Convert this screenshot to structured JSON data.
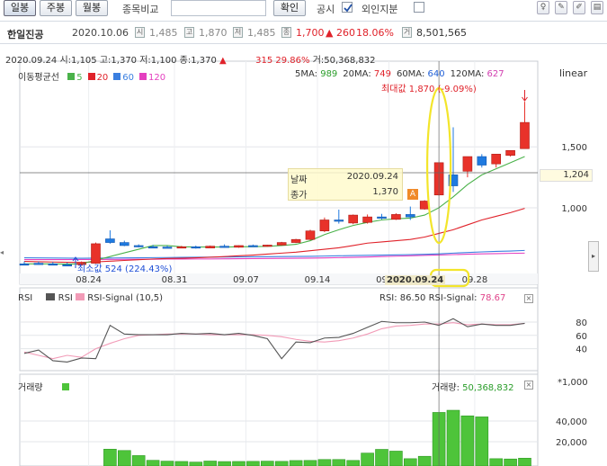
{
  "toolbar": {
    "daily": "일봉",
    "weekly": "주봉",
    "monthly": "월봉",
    "compare_label": "종목비교",
    "confirm": "확인",
    "disclosure": "공시",
    "foreign": "외인지분"
  },
  "quote": {
    "name": "한일진공",
    "date": "2020.10.06",
    "open_icon": "시",
    "open": "1,485",
    "high_icon": "고",
    "high": "1,870",
    "low_icon": "저",
    "low": "1,485",
    "close_icon": "종",
    "close": "1,700",
    "change": "▲ 260",
    "pct": "18.06%",
    "vol_icon": "거",
    "volume": "8,501,565"
  },
  "info": {
    "date": "2020.09.24",
    "open": "시:1,105",
    "high": "고:1,370",
    "low": "저:1,100",
    "close": "종:1,370",
    "arrow": "▲",
    "change": "315",
    "pct": "29.86%",
    "volume": "거:50,368,832"
  },
  "ma_legend": {
    "title": "이동평균선",
    "items": [
      {
        "label": "5",
        "color": "#4ab24a"
      },
      {
        "label": "20",
        "color": "#e0222a"
      },
      {
        "label": "60",
        "color": "#3a7fe0"
      },
      {
        "label": "120",
        "color": "#e43fbf"
      }
    ],
    "values": [
      {
        "label": "5MA:",
        "value": "989",
        "color": "#2a9d2a"
      },
      {
        "label": "20MA:",
        "value": "749",
        "color": "#e0222a"
      },
      {
        "label": "60MA:",
        "value": "640",
        "color": "#1f5fd6"
      },
      {
        "label": "120MA:",
        "value": "627",
        "color": "#d23fb0"
      }
    ],
    "scale": "linear"
  },
  "annotations": {
    "max": "최대값 1,870 (-9.09%)",
    "min": "최소값 524 (224.43%)",
    "tooltip_date_label": "날짜",
    "tooltip_date": "2020.09.24",
    "tooltip_close_label": "종가",
    "tooltip_close": "1,370",
    "crosshair_price": "1,204",
    "crosshair_date": "2020.09.24",
    "marker": "A"
  },
  "rsi": {
    "title": "RSI",
    "legend1": "RSI",
    "legend2": "RSI-Signal (10,5)",
    "readout": "RSI: 86.50",
    "readout_signal": "RSI-Signal:",
    "signal_value": "78.67"
  },
  "volume": {
    "title": "거래량",
    "readout": "거래량:",
    "value": "50,368,832",
    "unit": "*1,000"
  },
  "chart_data": {
    "type": "candlestick",
    "x_ticks": [
      "08.24",
      "08.31",
      "09.07",
      "09.14",
      "09.21",
      "09.28"
    ],
    "price_ticks": [
      1000,
      1500
    ],
    "candles": [
      {
        "o": 540,
        "h": 560,
        "c": 540,
        "l": 528,
        "up": false
      },
      {
        "o": 545,
        "h": 560,
        "c": 540,
        "l": 532,
        "up": false
      },
      {
        "o": 540,
        "h": 555,
        "c": 535,
        "l": 528,
        "up": false
      },
      {
        "o": 533,
        "h": 550,
        "c": 528,
        "l": 524,
        "up": false
      },
      {
        "o": 535,
        "h": 560,
        "c": 545,
        "l": 524,
        "up": true
      },
      {
        "o": 545,
        "h": 715,
        "c": 705,
        "l": 540,
        "up": true
      },
      {
        "o": 745,
        "h": 815,
        "c": 715,
        "l": 705,
        "up": false
      },
      {
        "o": 715,
        "h": 730,
        "c": 690,
        "l": 685,
        "up": false
      },
      {
        "o": 690,
        "h": 700,
        "c": 680,
        "l": 675,
        "up": false
      },
      {
        "o": 680,
        "h": 695,
        "c": 678,
        "l": 670,
        "up": false
      },
      {
        "o": 678,
        "h": 690,
        "c": 672,
        "l": 668,
        "up": false
      },
      {
        "o": 672,
        "h": 688,
        "c": 680,
        "l": 668,
        "up": true
      },
      {
        "o": 680,
        "h": 690,
        "c": 670,
        "l": 665,
        "up": false
      },
      {
        "o": 670,
        "h": 690,
        "c": 685,
        "l": 668,
        "up": true
      },
      {
        "o": 685,
        "h": 700,
        "c": 676,
        "l": 672,
        "up": false
      },
      {
        "o": 676,
        "h": 692,
        "c": 690,
        "l": 672,
        "up": true
      },
      {
        "o": 690,
        "h": 698,
        "c": 683,
        "l": 680,
        "up": false
      },
      {
        "o": 683,
        "h": 697,
        "c": 694,
        "l": 680,
        "up": true
      },
      {
        "o": 694,
        "h": 720,
        "c": 715,
        "l": 690,
        "up": true
      },
      {
        "o": 715,
        "h": 745,
        "c": 740,
        "l": 710,
        "up": true
      },
      {
        "o": 740,
        "h": 820,
        "c": 810,
        "l": 735,
        "up": true
      },
      {
        "o": 810,
        "h": 920,
        "c": 900,
        "l": 800,
        "up": true
      },
      {
        "o": 900,
        "h": 985,
        "c": 895,
        "l": 870,
        "up": false
      },
      {
        "o": 875,
        "h": 945,
        "c": 940,
        "l": 865,
        "up": true
      },
      {
        "o": 880,
        "h": 945,
        "c": 925,
        "l": 870,
        "up": true
      },
      {
        "o": 925,
        "h": 950,
        "c": 918,
        "l": 905,
        "up": false
      },
      {
        "o": 905,
        "h": 955,
        "c": 945,
        "l": 900,
        "up": true
      },
      {
        "o": 945,
        "h": 1010,
        "c": 925,
        "l": 900,
        "up": false
      },
      {
        "o": 990,
        "h": 1062,
        "c": 1055,
        "l": 985,
        "up": true
      },
      {
        "o": 1105,
        "h": 1370,
        "c": 1370,
        "l": 1100,
        "up": true
      },
      {
        "o": 1270,
        "h": 1660,
        "c": 1180,
        "l": 1130,
        "up": false
      },
      {
        "o": 1300,
        "h": 1420,
        "c": 1420,
        "l": 1250,
        "up": true
      },
      {
        "o": 1420,
        "h": 1440,
        "c": 1350,
        "l": 1330,
        "up": false
      },
      {
        "o": 1360,
        "h": 1440,
        "c": 1440,
        "l": 1330,
        "up": true
      },
      {
        "o": 1430,
        "h": 1470,
        "c": 1470,
        "l": 1420,
        "up": true
      },
      {
        "o": 1485,
        "h": 1870,
        "c": 1700,
        "l": 1485,
        "up": true
      }
    ],
    "ma5": [
      540,
      540,
      540,
      538,
      540,
      570,
      600,
      630,
      660,
      690,
      690,
      680,
      678,
      678,
      678,
      680,
      681,
      684,
      690,
      700,
      730,
      780,
      820,
      855,
      880,
      900,
      910,
      915,
      940,
      1000,
      1090,
      1190,
      1270,
      1320,
      1370,
      1420
    ],
    "ma20": [
      560,
      557,
      555,
      553,
      552,
      556,
      562,
      568,
      574,
      580,
      584,
      586,
      590,
      594,
      600,
      606,
      612,
      620,
      628,
      636,
      648,
      660,
      672,
      690,
      710,
      720,
      730,
      740,
      760,
      790,
      820,
      860,
      900,
      930,
      960,
      995
    ],
    "ma60": [
      590,
      589,
      588,
      587,
      586,
      587,
      588,
      589,
      590,
      591,
      592,
      593,
      594,
      595,
      596,
      597,
      598,
      599,
      600,
      601,
      602,
      604,
      606,
      608,
      610,
      612,
      614,
      616,
      618,
      622,
      628,
      633,
      638,
      642,
      645,
      650
    ],
    "ma120": [
      575,
      575,
      575,
      575,
      576,
      576,
      577,
      577,
      578,
      578,
      579,
      579,
      580,
      580,
      581,
      582,
      583,
      584,
      585,
      586,
      587,
      589,
      591,
      593,
      596,
      600,
      603,
      606,
      610,
      613,
      616,
      619,
      622,
      624,
      626,
      628
    ],
    "rsi_ticks": [
      40,
      60,
      80
    ],
    "rsi": [
      33,
      38,
      22,
      20,
      26,
      25,
      75,
      62,
      61,
      61,
      61,
      63,
      62,
      63,
      61,
      63,
      60,
      55,
      25,
      50,
      49,
      56,
      57,
      63,
      72,
      81,
      79,
      79,
      80,
      75,
      85,
      73,
      77,
      75,
      75,
      78
    ],
    "rsi_signal": [
      35,
      30,
      25,
      30,
      27,
      40,
      48,
      55,
      60,
      61,
      62,
      62,
      62,
      61,
      61,
      61,
      61,
      60,
      58,
      54,
      51,
      50,
      52,
      56,
      62,
      70,
      74,
      75,
      77,
      77,
      79,
      76,
      77,
      76,
      76,
      78
    ],
    "volume_ticks": [
      20000,
      40000
    ],
    "volume_k": [
      0,
      0,
      0,
      0,
      0,
      0,
      12800,
      11500,
      6600,
      2000,
      1200,
      900,
      300,
      1300,
      800,
      900,
      1000,
      1200,
      1000,
      1800,
      1900,
      2800,
      2800,
      1900,
      9000,
      12600,
      10900,
      3600,
      5900,
      48300,
      50400,
      45000,
      44000,
      3600,
      3300,
      4100
    ],
    "volume_up": [
      false,
      false,
      false,
      false,
      false,
      true,
      true,
      false,
      false,
      true,
      false,
      true,
      false,
      true,
      false,
      true,
      false,
      true,
      true,
      true,
      true,
      true,
      false,
      true,
      true,
      true,
      false,
      true,
      true,
      true,
      false,
      true,
      false,
      true,
      true,
      true
    ]
  }
}
